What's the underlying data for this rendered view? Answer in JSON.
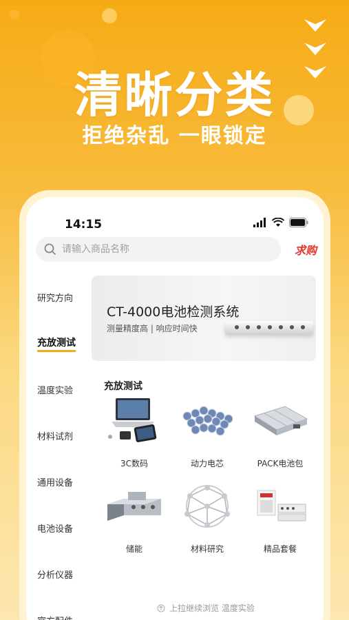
{
  "hero": {
    "title": "清晰分类",
    "subtitle": "拒绝杂乱 一眼锁定"
  },
  "status_bar": {
    "time": "14:15"
  },
  "search": {
    "placeholder": "请输入商品名称",
    "request_button": "求购"
  },
  "sidebar": {
    "items": [
      {
        "label": "研究方向",
        "active": false
      },
      {
        "label": "充放测试",
        "active": true
      },
      {
        "label": "温度实验",
        "active": false
      },
      {
        "label": "材料试剂",
        "active": false
      },
      {
        "label": "通用设备",
        "active": false
      },
      {
        "label": "电池设备",
        "active": false
      },
      {
        "label": "分析仪器",
        "active": false
      },
      {
        "label": "官方配件",
        "active": false
      }
    ]
  },
  "banner": {
    "title": "CT-4000电池检测系统",
    "subtitle": "测量精度高 | 响应时间快"
  },
  "section": {
    "title": "充放测试",
    "items": [
      {
        "label": "3C数码",
        "icon": "laptop-tablet-icon"
      },
      {
        "label": "动力电芯",
        "icon": "battery-cells-icon"
      },
      {
        "label": "PACK电池包",
        "icon": "battery-pack-icon"
      },
      {
        "label": "储能",
        "icon": "energy-storage-icon"
      },
      {
        "label": "材料研究",
        "icon": "molecule-icon"
      },
      {
        "label": "精品套餐",
        "icon": "instrument-set-icon"
      }
    ]
  },
  "footer": {
    "hint": "上拉继续浏览  温度实验"
  },
  "colors": {
    "accent": "#f6ab15",
    "request": "#e8362a"
  }
}
